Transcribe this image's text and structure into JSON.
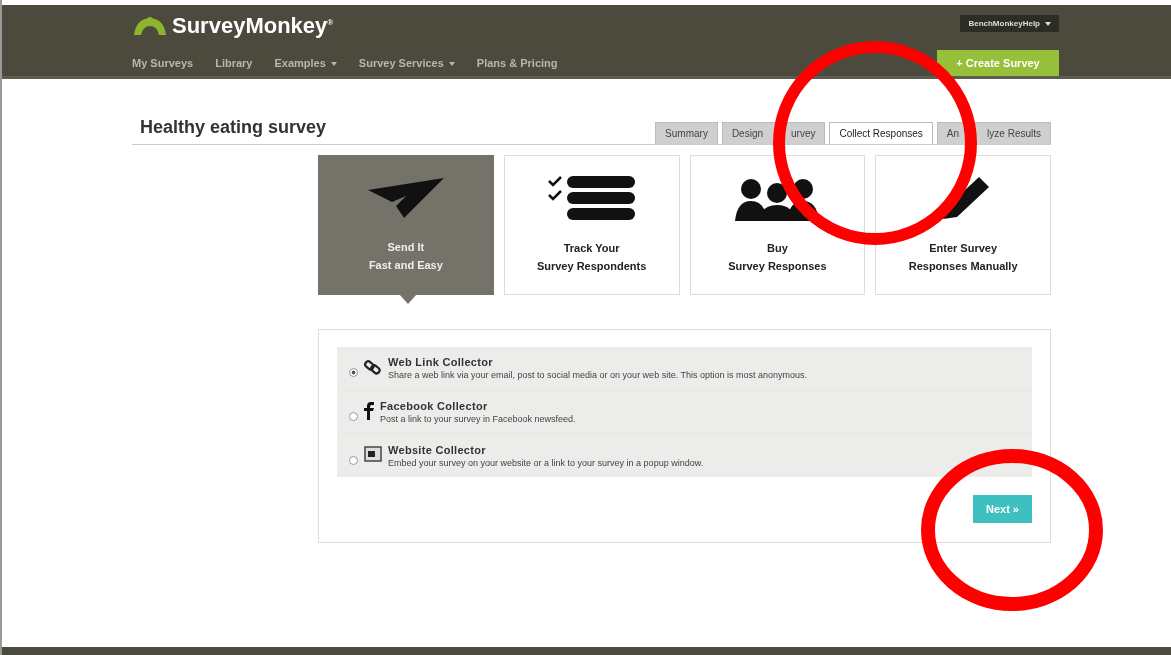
{
  "header": {
    "logo": "SurveyMonkey",
    "logo_mark": "®",
    "nav": [
      {
        "label": "My Surveys",
        "dropdown": false
      },
      {
        "label": "Library",
        "dropdown": false
      },
      {
        "label": "Examples",
        "dropdown": true
      },
      {
        "label": "Survey Services",
        "dropdown": true
      },
      {
        "label": "Plans & Pricing",
        "dropdown": false
      }
    ],
    "account": "BenchMonkeyHelp",
    "create_button": "+ Create Survey"
  },
  "survey_title": "Healthy eating survey",
  "tabs": [
    {
      "parts": [
        "Summary"
      ],
      "selected": false
    },
    {
      "parts": [
        "Design",
        "urvey"
      ],
      "selected": false
    },
    {
      "parts": [
        "Collect Responses"
      ],
      "selected": true
    },
    {
      "parts": [
        "An",
        "lyze Results"
      ],
      "selected": false
    }
  ],
  "options": [
    {
      "kind": "send",
      "lines": [
        "Send It",
        "Fast and Easy"
      ],
      "selected": true
    },
    {
      "kind": "track",
      "lines": [
        "Track Your",
        "Survey Respondents"
      ],
      "selected": false
    },
    {
      "kind": "buy",
      "lines": [
        "Buy",
        "Survey Responses"
      ],
      "selected": false
    },
    {
      "kind": "manual",
      "lines": [
        "Enter Survey",
        "Responses Manually"
      ],
      "selected": false
    }
  ],
  "collectors": [
    {
      "kind": "link",
      "title": "Web Link Collector",
      "description": "Share a web link via your email, post to social media or on your web site. This option is most anonymous.",
      "selected": true
    },
    {
      "kind": "facebook",
      "title": "Facebook Collector",
      "description": "Post a link to your survey in Facebook newsfeed.",
      "selected": false
    },
    {
      "kind": "website",
      "title": "Website Collector",
      "description": "Embed your survey on your website or a link to your survey in a popup window.",
      "selected": false
    }
  ],
  "next_button": "Next »"
}
